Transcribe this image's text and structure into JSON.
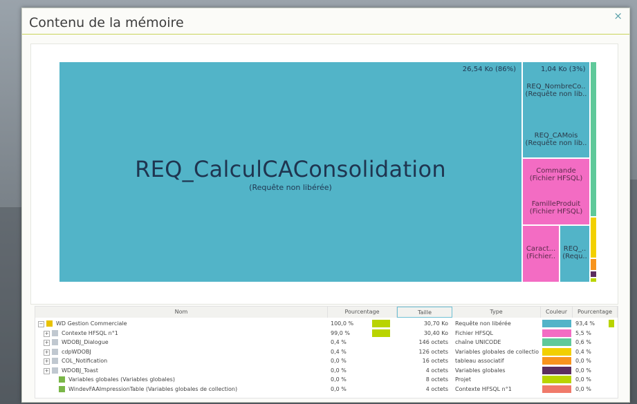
{
  "window": {
    "title": "Contenu de la mémoire",
    "close_symbol": "×"
  },
  "treemap": {
    "main": {
      "name": "REQ_CalculCAConsolidation",
      "subtitle": "(Requête non libérée)",
      "size_label": "26,54 Ko (86%)",
      "color": "#52b4c8"
    },
    "second_size_label": "1,04 Ko (3%)",
    "blocks": [
      {
        "line1": "REQ_NombreCo..",
        "line2": "(Requête non lib..",
        "color": "#52b4c8"
      },
      {
        "line1": "REQ_CAMois",
        "line2": "(Requête non lib..",
        "color": "#52b4c8"
      },
      {
        "line1": "Commande",
        "line2": "(Fichier HFSQL)",
        "color": "#f36cc3"
      },
      {
        "line1": "FamilleProduit",
        "line2": "(Fichier HFSQL)",
        "color": "#f36cc3"
      },
      {
        "line1": "Caract...",
        "line2": "(Fichier..",
        "color": "#f36cc3"
      },
      {
        "line1": "REQ_..",
        "line2": "(Requ..",
        "color": "#52b4c8"
      }
    ]
  },
  "table": {
    "headers": {
      "nom": "Nom",
      "pourcentage": "Pourcentage",
      "taille": "Taille"
    },
    "rows": [
      {
        "name": "WD Gestion Commerciale",
        "pct": "100,0 %",
        "size": "30,70 Ko",
        "bar": 1.0,
        "tree": "−"
      },
      {
        "name": "Contexte HFSQL n°1",
        "pct": "99,0 %",
        "size": "30,40 Ko",
        "bar": 0.99,
        "tree": "+"
      },
      {
        "name": "WDOBJ_Dialogue",
        "pct": "0,4 %",
        "size": "146 octets",
        "bar": 0.0,
        "tree": "+"
      },
      {
        "name": "cdpWDOBJ",
        "pct": "0,4 %",
        "size": "126 octets",
        "bar": 0.0,
        "tree": "+"
      },
      {
        "name": "COL_Notification",
        "pct": "0,0 %",
        "size": "16 octets",
        "bar": 0.0,
        "tree": "+"
      },
      {
        "name": "WDOBJ_Toast",
        "pct": "0,0 %",
        "size": "4 octets",
        "bar": 0.0,
        "tree": "+"
      },
      {
        "name": "Variables globales (Variables globales)",
        "pct": "0,0 %",
        "size": "8 octets",
        "bar": 0.0,
        "tree": ""
      },
      {
        "name": "WindevFAAImpressionTable (Variables globales de collection)",
        "pct": "0,0 %",
        "size": "4 octets",
        "bar": 0.0,
        "tree": ""
      }
    ]
  },
  "legend": {
    "headers": {
      "type": "Type",
      "couleur": "Couleur",
      "pourcentage": "Pourcentage"
    },
    "rows": [
      {
        "type": "Requête non libérée",
        "color": "#52b4c8",
        "pct": "93,4 %"
      },
      {
        "type": "Fichier HFSQL",
        "color": "#f36cc3",
        "pct": "5,5 %"
      },
      {
        "type": "chaîne UNICODE",
        "color": "#5fc99a",
        "pct": "0,6 %"
      },
      {
        "type": "Variables globales de collectio",
        "color": "#f2d000",
        "pct": "0,4 %"
      },
      {
        "type": "tableau associatif",
        "color": "#f7941d",
        "pct": "0,0 %"
      },
      {
        "type": "Variables globales",
        "color": "#5b2d5e",
        "pct": "0,0 %"
      },
      {
        "type": "Projet",
        "color": "#b9d400",
        "pct": "0,0 %"
      },
      {
        "type": "Contexte HFSQL n°1",
        "color": "#f07a6a",
        "pct": "0,0 %"
      }
    ]
  }
}
